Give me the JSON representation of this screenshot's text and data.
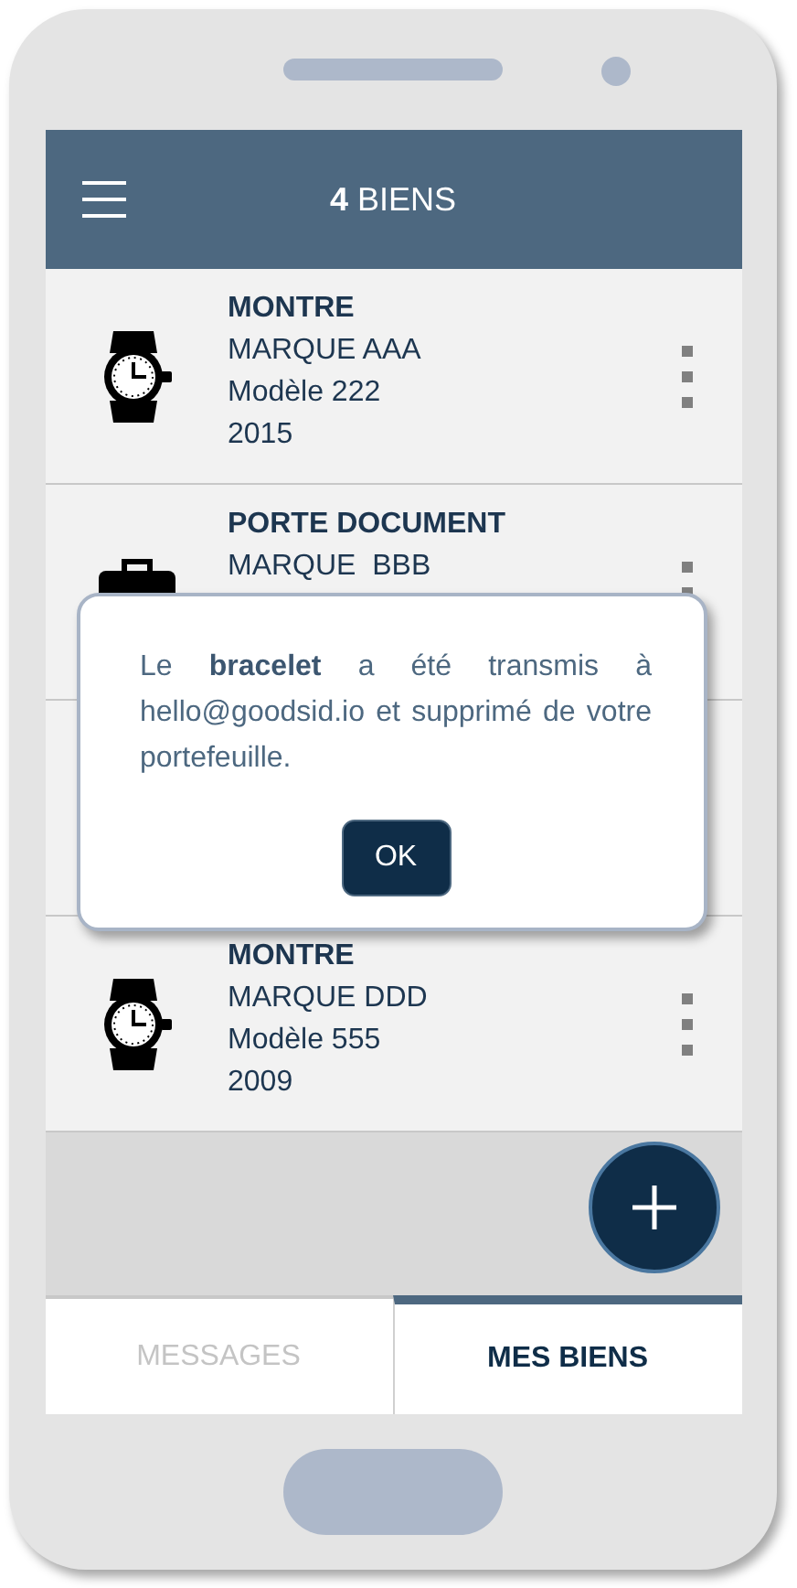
{
  "header": {
    "title": "**4** BIENS"
  },
  "items": [
    {
      "kind": "watch",
      "title": "MONTRE",
      "brand": "MARQUE AAA",
      "model": "Modèle 222",
      "year": "2015"
    },
    {
      "kind": "briefcase",
      "title": "PORTE DOCUMENT",
      "brand": "MARQUE  BBB"
    },
    {
      "kind": "covered"
    },
    {
      "kind": "watch",
      "title": "MONTRE",
      "brand": "MARQUE DDD",
      "model": "Modèle 555",
      "year": "2009"
    }
  ],
  "dialog": {
    "message": "Le **bracelet** a été transmis à hello@goodsid.io et supprimé de votre portefeuille.",
    "button": "OK"
  },
  "tabs": [
    {
      "label": "MESSAGES",
      "selected": false
    },
    {
      "label": "MES BIENS",
      "selected": true
    }
  ]
}
